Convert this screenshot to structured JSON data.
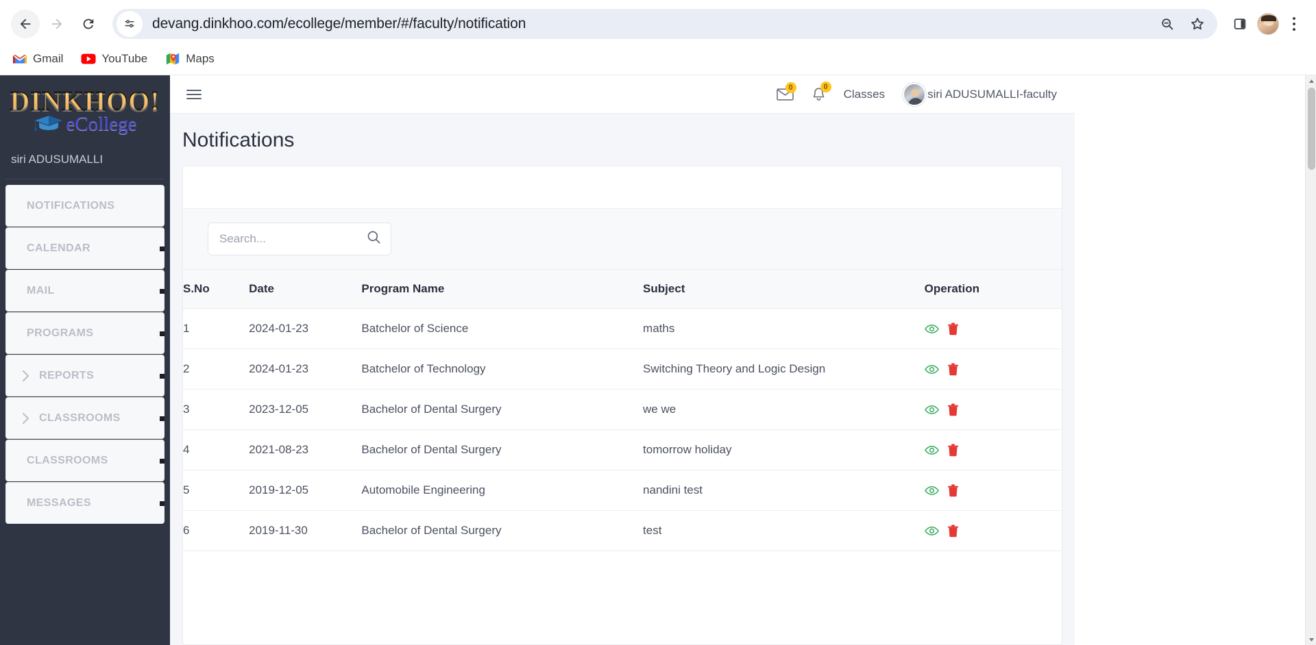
{
  "browser": {
    "back_icon": "back-arrow-icon",
    "forward_icon": "forward-arrow-icon",
    "reload_icon": "reload-icon",
    "site_info_icon": "site-settings-icon",
    "url": "devang.dinkhoo.com/ecollege/member/#/faculty/notification",
    "zoom_icon": "zoom-out-icon",
    "bookmark_icon": "star-icon",
    "side_panel_icon": "side-panel-icon",
    "profile_icon": "profile-avatar",
    "menu_icon": "three-dot-menu-icon",
    "bookmarks": [
      {
        "label": "Gmail",
        "icon": "gmail-icon"
      },
      {
        "label": "YouTube",
        "icon": "youtube-icon"
      },
      {
        "label": "Maps",
        "icon": "maps-icon"
      }
    ]
  },
  "sidebar": {
    "logo_main": "DINKHOO!",
    "logo_sub": "eCollege",
    "user_name": "siri ADUSUMALLI",
    "items": [
      {
        "label": "NOTIFICATIONS",
        "expandable": false
      },
      {
        "label": "CALENDAR",
        "expandable": false
      },
      {
        "label": "MAIL",
        "expandable": false
      },
      {
        "label": "PROGRAMS",
        "expandable": false
      },
      {
        "label": "REPORTS",
        "expandable": true
      },
      {
        "label": "CLASSROOMS",
        "expandable": true
      },
      {
        "label": "CLASSROOMS",
        "expandable": false
      },
      {
        "label": "MESSAGES",
        "expandable": false
      }
    ]
  },
  "topbar": {
    "menu_toggle_icon": "hamburger-icon",
    "mail_icon": "envelope-icon",
    "mail_count": "0",
    "bell_icon": "bell-icon",
    "bell_count": "0",
    "classes_label": "Classes",
    "user_label": "siri ADUSUMALLI-faculty",
    "avatar_icon": "user-avatar"
  },
  "main": {
    "page_title": "Notifications",
    "search": {
      "placeholder": "Search...",
      "value": "",
      "icon": "search-icon"
    },
    "table": {
      "columns": [
        "S.No",
        "Date",
        "Program Name",
        "Subject",
        "Operation"
      ],
      "rows": [
        {
          "sno": "1",
          "date": "2024-01-23",
          "program": "Batchelor of Science",
          "subject": "maths"
        },
        {
          "sno": "2",
          "date": "2024-01-23",
          "program": "Batchelor of Technology",
          "subject": "Switching Theory and Logic Design"
        },
        {
          "sno": "3",
          "date": "2023-12-05",
          "program": "Bachelor of Dental Surgery",
          "subject": "we we"
        },
        {
          "sno": "4",
          "date": "2021-08-23",
          "program": "Bachelor of Dental Surgery",
          "subject": "tomorrow holiday"
        },
        {
          "sno": "5",
          "date": "2019-12-05",
          "program": "Automobile Engineering",
          "subject": "nandini test"
        },
        {
          "sno": "6",
          "date": "2019-11-30",
          "program": "Bachelor of Dental Surgery",
          "subject": "test"
        }
      ],
      "ops": {
        "view_icon": "eye-icon",
        "delete_icon": "trash-icon"
      }
    }
  },
  "colors": {
    "sidebar_bg": "#2f3542",
    "badge": "#ffc41f",
    "view_icon": "#2eaa55",
    "delete_icon": "#e53935",
    "logo_orange": "#f7a11a",
    "logo_blue": "#4b4bd8"
  }
}
